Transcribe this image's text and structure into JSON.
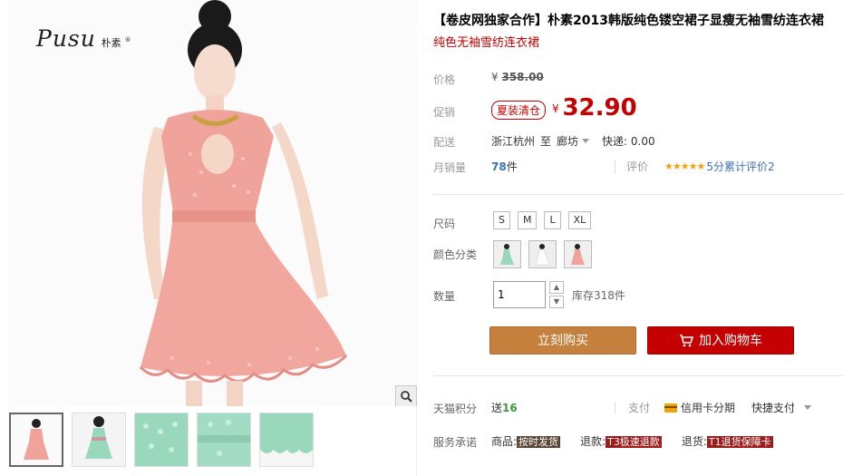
{
  "gallery": {
    "brand_script": "Pusu",
    "brand_cn": "朴素",
    "brand_reg": "®",
    "thumbnails": [
      "pink-front",
      "pink-back",
      "mint-detail",
      "mint-bodice",
      "mint-hem"
    ]
  },
  "product": {
    "title": "【卷皮网独家合作】朴素2013韩版纯色镂空裙子显瘦无袖雪纺连衣裙",
    "subtitle": "纯色无袖雪纺连衣裙"
  },
  "price": {
    "label": "价格",
    "currency": "¥",
    "original": "358.00"
  },
  "promo": {
    "label": "促销",
    "badge": "夏装清仓",
    "currency": "¥",
    "price": "32.90"
  },
  "shipping": {
    "label": "配送",
    "origin": "浙江杭州",
    "to": "至",
    "destination": "廊坊",
    "fee": "快递: 0.00"
  },
  "sales": {
    "label": "月销量",
    "count": "78",
    "unit": "件",
    "review_label": "评价",
    "stars": "★★★★★",
    "score": "5分累计评价2"
  },
  "size": {
    "label": "尺码",
    "options": [
      "S",
      "M",
      "L",
      "XL"
    ]
  },
  "color": {
    "label": "颜色分类",
    "options": [
      "mint-green",
      "white",
      "pink"
    ]
  },
  "quantity": {
    "label": "数量",
    "value": "1",
    "stock": "库存318件"
  },
  "buttons": {
    "buy_now": "立刻购买",
    "add_cart": "加入购物车"
  },
  "points": {
    "label": "天猫积分",
    "text": "送",
    "value": "16"
  },
  "payment": {
    "label": "支付",
    "credit": "信用卡分期",
    "quick": "快捷支付"
  },
  "service": {
    "label": "服务承诺",
    "goods_label": "商品:",
    "goods_tag": "按时发货",
    "refund_label": "退款:",
    "refund_tag": "T3极速退款",
    "return_label": "退货:",
    "return_tag": "T1退货保障卡"
  },
  "colors": {
    "accent_red": "#c40000",
    "buy_button": "#c4803c",
    "cart_button": "#c40000",
    "dress_pink": "#f0a39a",
    "dress_mint": "#9ad8bd"
  }
}
